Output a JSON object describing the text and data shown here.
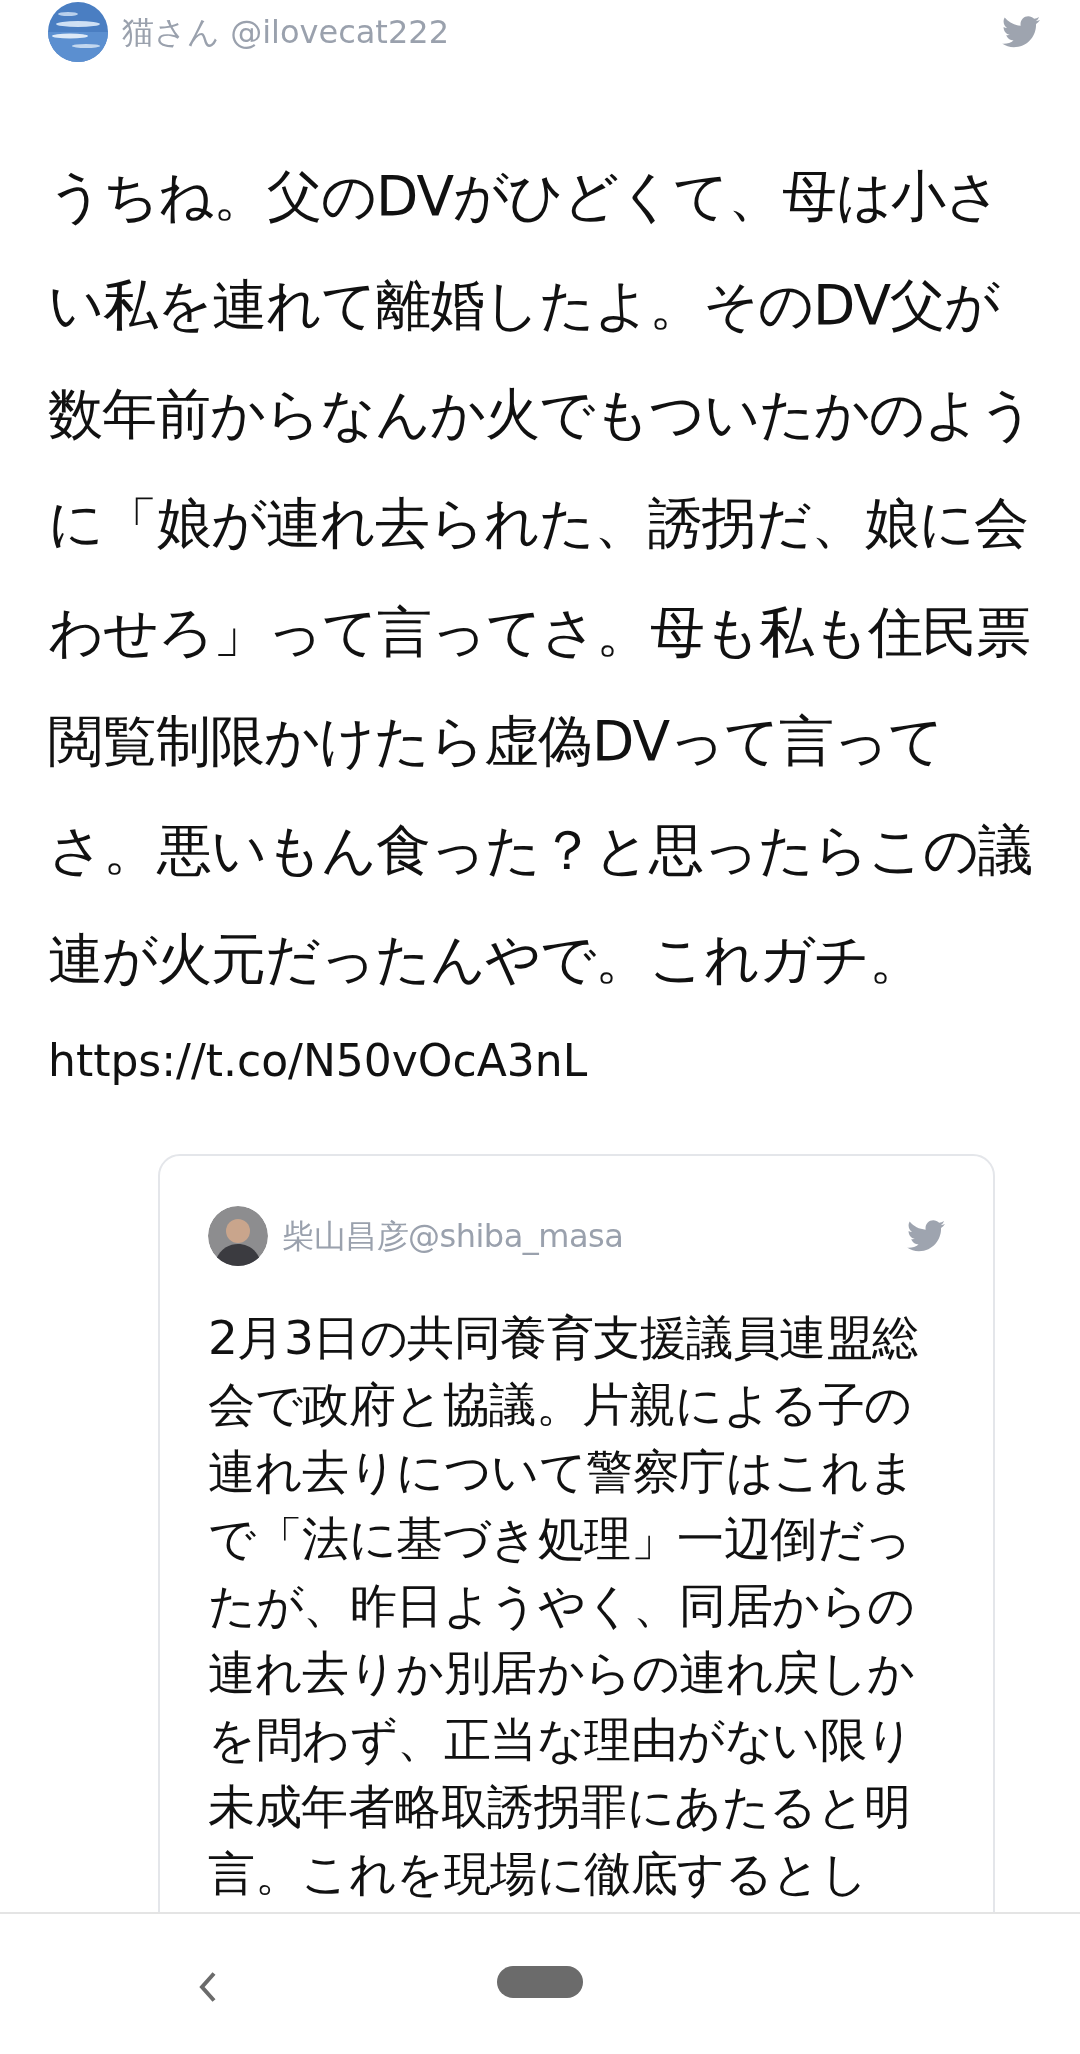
{
  "tweet": {
    "author": "猫さん @ilovecat222",
    "text": "うちね。父のDVがひどくて、母は小さい私を連れて離婚したよ。そのDV父が数年前からなんか火でもついたかのように「娘が連れ去られた、誘拐だ、娘に会わせろ」って言ってさ。母も私も住民票閲覧制限かけたら虚偽DVって言ってさ。悪いもん食った？と思ったらこの議連が火元だったんやで。これガチ。",
    "link": "https://t.co/N50vOcA3nL"
  },
  "quoted_tweet": {
    "author": "柴山昌彦@shiba_masa",
    "text": "2月3日の共同養育支援議員連盟総会で政府と協議。片親による子の連れ去りについて警察庁はこれまで「法に基づき処理」一辺倒だったが、昨日ようやく、同居からの連れ去りか別居からの連れ戻しかを問わず、正当な理由がない限り未成年者略取誘拐罪にあたると明言。これを現場に徹底するとし"
  }
}
